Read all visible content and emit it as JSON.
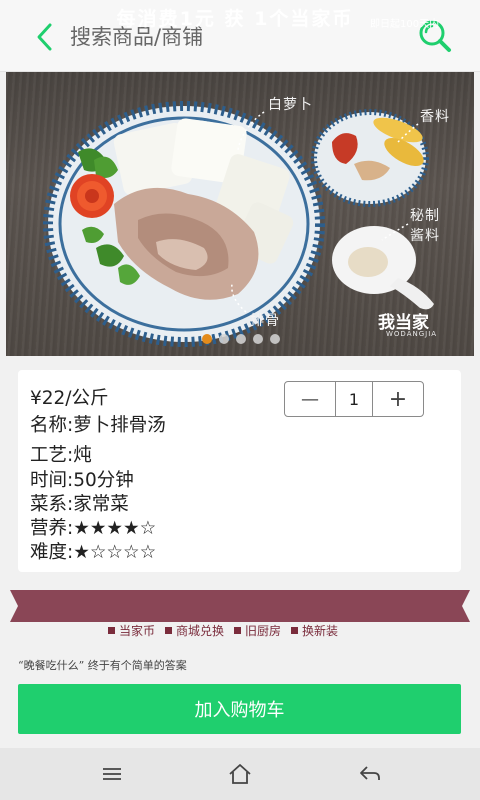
{
  "header": {
    "back_icon": "chevron-left-icon",
    "search_placeholder": "搜索商品/商铺",
    "search_icon": "search-icon",
    "accent_color": "#1fcf6e"
  },
  "banner": {
    "labels": {
      "radish": "白萝卜",
      "spice": "香料",
      "sauce": "秘制\n酱料",
      "ribs": "排骨"
    },
    "watermark": "我当家",
    "watermark_sub": "WODANGJIA",
    "carousel": {
      "count": 5,
      "active_index": 0
    },
    "active_dot_color": "#e38b1b"
  },
  "product": {
    "price": "¥22/公斤",
    "name": "名称:萝卜排骨汤",
    "technique": "工艺:炖",
    "time": "时间:50分钟",
    "cuisine": "菜系:家常菜",
    "nutrition": "营养:★★★★☆",
    "difficulty": "难度:★☆☆☆☆"
  },
  "stepper": {
    "minus": "—",
    "quantity": "1",
    "plus": "+"
  },
  "promo": {
    "headline": "每消费1元 获 1个当家币",
    "tag": "即日起100天内",
    "links": [
      "当家币",
      "商城兑换",
      "旧厨房",
      "换新装"
    ],
    "quote": "“晚餐吃什么” 终于有个简单的答案",
    "band_color": "#8a4656"
  },
  "cart": {
    "label": "加入购物车",
    "color": "#1fcf6e"
  },
  "navbar": {
    "menu_icon": "menu-icon",
    "home_icon": "home-icon",
    "back_icon": "back-arrow-icon"
  }
}
